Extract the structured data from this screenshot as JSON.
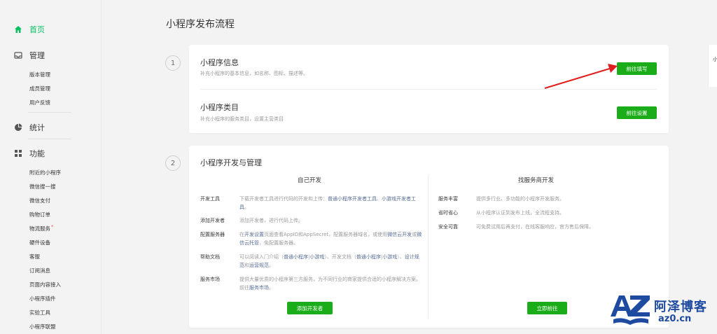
{
  "sidebar": {
    "home": "首页",
    "manage": "管理",
    "manage_items": [
      "版本管理",
      "成员管理",
      "用户反馈"
    ],
    "stats": "统计",
    "features": "功能",
    "feature_items": [
      "附近的小程序",
      "微信搜一搜",
      "微信支付",
      "购物订单",
      "物流服务",
      "硬件设备",
      "客服",
      "订阅消息",
      "页面内容接入",
      "小程序插件",
      "实验工具",
      "小程序联盟"
    ],
    "required_mark": "*"
  },
  "page": {
    "title": "小程序发布流程"
  },
  "step1": {
    "number": "1",
    "info_title": "小程序信息",
    "info_desc": "补充小程序的基本信息，如名称、图标、描述等。",
    "info_button": "前往填写",
    "category_title": "小程序类目",
    "category_desc": "补充小程序的服务类目，设置主营类目",
    "category_button": "前往设置"
  },
  "step2": {
    "number": "2",
    "title": "小程序开发与管理",
    "self_dev": {
      "heading": "自己开发",
      "items": [
        {
          "label": "开发工具",
          "pre": "下载开发者工具进行代码的开发和上传：",
          "link1": "普通小程序开发者工具",
          "mid": "、",
          "link2": "小游戏开发者工具",
          "post": "。"
        },
        {
          "label": "添加开发者",
          "pre": "添加开发者，进行代码上传。"
        },
        {
          "label": "配置服务器",
          "pre": "在",
          "link1": "开发设置",
          "mid": "页面查看AppID和AppSecret，配置服务器域名，或使用",
          "link2": "微信云开发",
          "mid2": "或",
          "link3": "微信云托管",
          "post": "，免配置服务器。"
        },
        {
          "label": "帮助文档",
          "pre": "可以阅读入门介绍（",
          "link1": "普通小程序",
          "mid": "|",
          "link2": "小游戏",
          "mid2": "）、开发文档（",
          "link3": "普通小程序",
          "mid3": "|",
          "link4": "小游戏",
          "mid4": "）、",
          "link5": "设计规范",
          "mid5": "和",
          "link6": "运营规范",
          "post": "。"
        },
        {
          "label": "服务市场",
          "pre": "提供大量优质的小程序第三方服务，为不同行业的商家提供合适的小程序解决方案。前往",
          "link1": "服务市场",
          "post": "。"
        }
      ],
      "button": "添加开发者"
    },
    "provider": {
      "heading": "找服务商开发",
      "items": [
        {
          "label": "服务丰富",
          "desc": "提供多行业、多功能的小程序开发服务。"
        },
        {
          "label": "省时省心",
          "desc": "从小程序认证到发布上线，全流程支持。"
        },
        {
          "label": "安全可靠",
          "desc": "可免费试用后再支付，在线客服响应，官方售后保障。"
        }
      ],
      "button": "立即前往"
    }
  },
  "right_edge_text": "小",
  "watermark": {
    "name": "阿泽博客",
    "url": "az0.cn",
    "logo_text": "AZ"
  },
  "colors": {
    "accent_green": "#1aad19",
    "active_green": "#07c160",
    "link_blue": "#576b95",
    "arrow_red": "#e02020",
    "watermark_blue": "#1e4aa0"
  }
}
